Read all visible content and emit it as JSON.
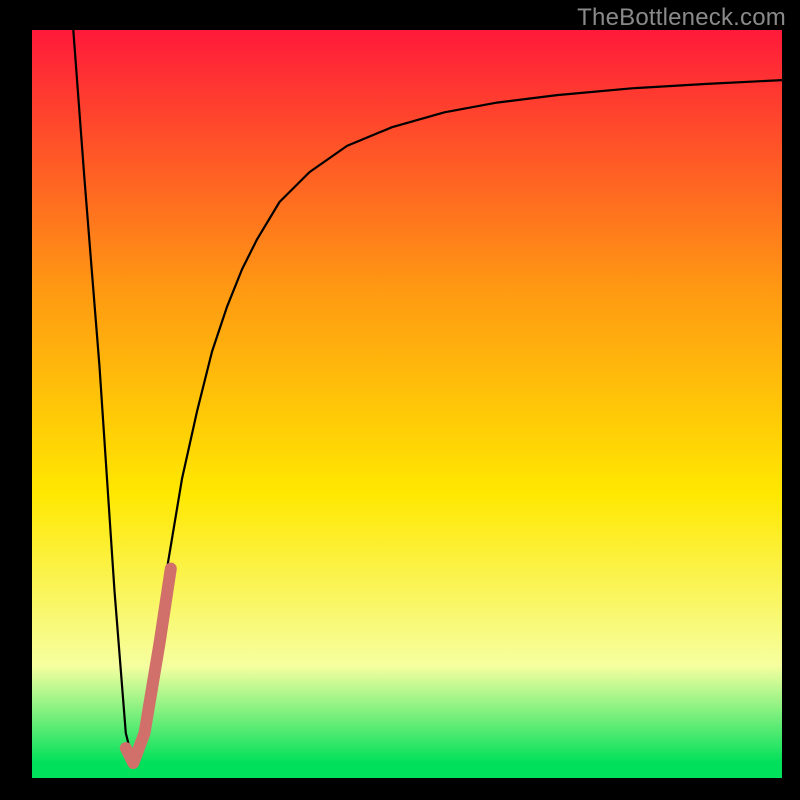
{
  "watermark": {
    "text": "TheBottleneck.com"
  },
  "colors": {
    "frame": "#000000",
    "gradient_top": "#ff1a3a",
    "gradient_mid1": "#ff9a12",
    "gradient_mid2": "#ffe800",
    "gradient_low": "#f6ffa0",
    "gradient_bottom": "#00e05a",
    "curve_main": "#000000",
    "curve_accent": "#d1706a"
  },
  "chart_data": {
    "type": "line",
    "title": "",
    "xlabel": "",
    "ylabel": "",
    "xlim": [
      0,
      100
    ],
    "ylim": [
      0,
      100
    ],
    "series": [
      {
        "name": "black-curve",
        "x": [
          5.5,
          7.0,
          9.0,
          11.0,
          12.5,
          13.5,
          14.5,
          16.0,
          18.0,
          20.0,
          22.0,
          24.0,
          26.0,
          28.0,
          30.0,
          33.0,
          37.0,
          42.0,
          48.0,
          55.0,
          62.0,
          70.0,
          80.0,
          90.0,
          100.0
        ],
        "y": [
          100.0,
          80.0,
          55.0,
          25.0,
          6.0,
          2.0,
          6.0,
          15.0,
          28.0,
          40.0,
          49.0,
          57.0,
          63.0,
          68.0,
          72.0,
          77.0,
          81.0,
          84.5,
          87.0,
          89.0,
          90.3,
          91.3,
          92.2,
          92.8,
          93.3
        ]
      },
      {
        "name": "pink-accent",
        "x": [
          12.5,
          13.5,
          15.0,
          17.0,
          18.5
        ],
        "y": [
          4.0,
          2.0,
          6.0,
          18.0,
          28.0
        ]
      }
    ],
    "gradient_stops": [
      {
        "offset": 0.0,
        "color": "#ff1a3a"
      },
      {
        "offset": 0.35,
        "color": "#ff9a12"
      },
      {
        "offset": 0.62,
        "color": "#ffe800"
      },
      {
        "offset": 0.85,
        "color": "#f6ffa0"
      },
      {
        "offset": 0.98,
        "color": "#00e05a"
      }
    ]
  }
}
